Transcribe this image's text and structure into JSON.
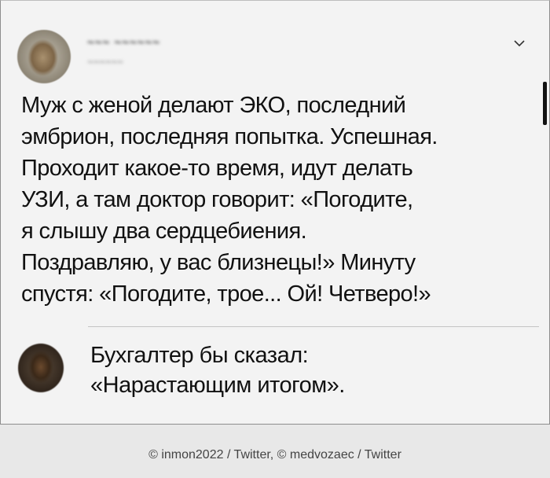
{
  "tweet": {
    "author_name": "~~~ ~~~~~~",
    "author_handle": "~~~~~~",
    "text_lines": [
      "Муж с женой делают ЭКО, последний",
      "эмбрион, последняя попытка. Успешная.",
      "Проходит какое-то время, идут делать",
      "УЗИ, а там доктор говорит: «Погодите,",
      "я слышу два сердцебиения.",
      "Поздравляю, у вас близнецы!» Минуту",
      "спустя: «Погодите, трое... Ой! Четверо!»"
    ]
  },
  "reply": {
    "text_lines": [
      "Бухгалтер бы сказал:",
      "«Нарастающим итогом»."
    ]
  },
  "caption": "© inmon2022 / Twitter, © medvozaec / Twitter",
  "icons": {
    "menu": "chevron-down-icon"
  },
  "colors": {
    "card_background": "#f3f3f3",
    "page_background": "#e8e8e8",
    "text": "#111111"
  }
}
